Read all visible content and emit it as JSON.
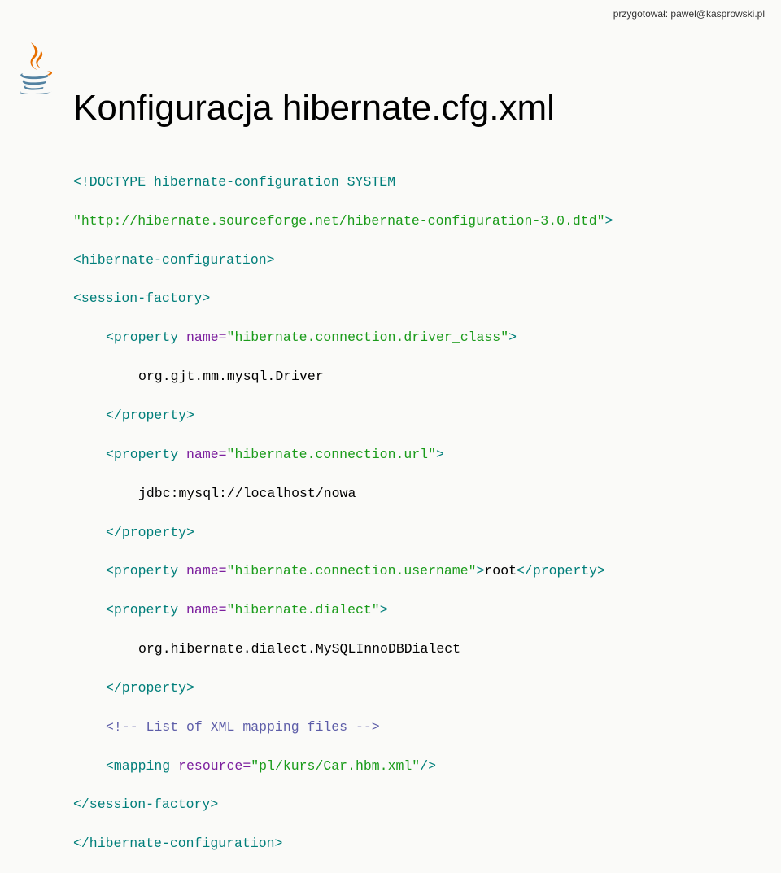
{
  "credit": "przygotował: pawel@kasprowski.pl",
  "title": "Konfiguracja hibernate.cfg.xml",
  "code": {
    "l1a": "<!DOCTYPE hibernate-configuration SYSTEM",
    "l2a": "\"http://hibernate.sourceforge.net/hibernate-configuration-3.0.dtd\"",
    "l2b": ">",
    "l3a": "<hibernate-configuration>",
    "l4a": "<session-factory>",
    "l5a": "<property ",
    "l5b": "name=",
    "l5c": "\"hibernate.connection.driver_class\"",
    "l5d": ">",
    "l6a": "org.gjt.mm.mysql.Driver",
    "l7a": "</property>",
    "l8a": "<property ",
    "l8b": "name=",
    "l8c": "\"hibernate.connection.url\"",
    "l8d": ">",
    "l9a": "jdbc:mysql://localhost/nowa",
    "l10a": "</property>",
    "l11a": "<property ",
    "l11b": "name=",
    "l11c": "\"hibernate.connection.username\"",
    "l11d": ">",
    "l11e": "root",
    "l11f": "</property>",
    "l12a": "<property ",
    "l12b": "name=",
    "l12c": "\"hibernate.dialect\"",
    "l12d": ">",
    "l13a": "org.hibernate.dialect.MySQLInnoDBDialect",
    "l14a": "</property>",
    "l15a": "<!-- List of XML mapping files -->",
    "l16a": "<mapping ",
    "l16b": "resource=",
    "l16c": "\"pl/kurs/Car.hbm.xml\"",
    "l16d": "/>",
    "l17a": "</session-factory>",
    "l18a": "</hibernate-configuration>"
  }
}
